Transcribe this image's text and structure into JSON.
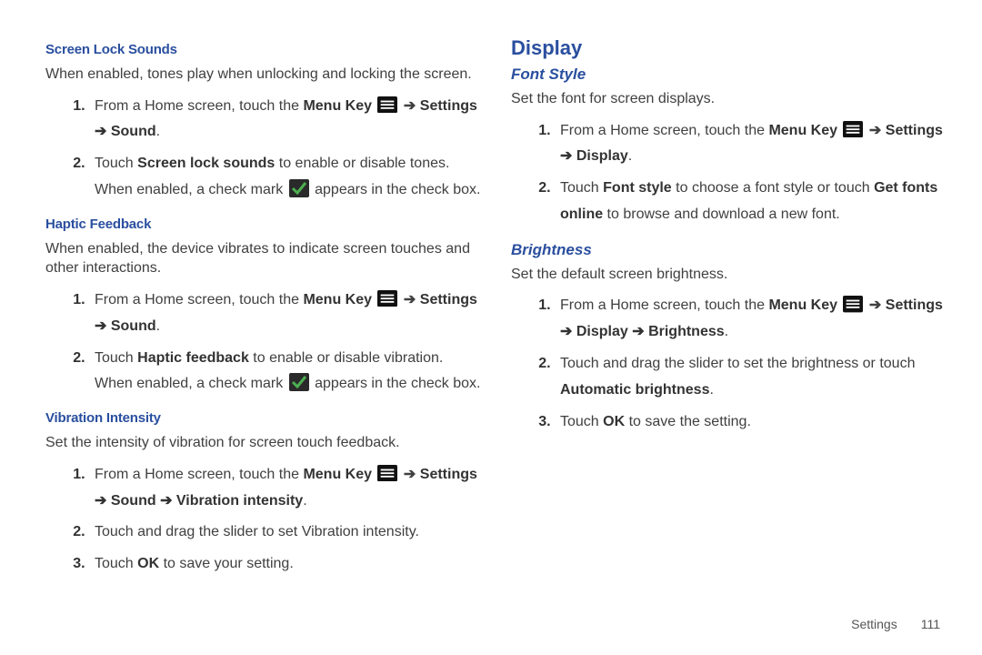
{
  "left": {
    "sections": [
      {
        "heading": "Screen Lock Sounds",
        "intro": "When enabled, tones play when unlocking and locking the screen.",
        "steps": [
          {
            "pre": "From a Home screen, touch the ",
            "b1": "Menu Key",
            "icon": "menu",
            "arrow1": " ➔ ",
            "b2": "Settings",
            "line2arrow": " ➔ ",
            "b3": "Sound",
            "tail": "."
          },
          {
            "pre": "Touch ",
            "b1": "Screen lock sounds",
            "mid": " to enable or disable tones. When enabled, a check mark ",
            "icon": "check",
            "tail": " appears in the check box."
          }
        ]
      },
      {
        "heading": "Haptic Feedback",
        "intro": "When enabled, the device vibrates to indicate screen touches and other interactions.",
        "steps": [
          {
            "pre": "From a Home screen, touch the ",
            "b1": "Menu Key",
            "icon": "menu",
            "arrow1": " ➔ ",
            "b2": "Settings",
            "line2arrow": " ➔ ",
            "b3": "Sound",
            "tail": "."
          },
          {
            "pre": "Touch ",
            "b1": "Haptic feedback",
            "mid": " to enable or disable vibration. When enabled, a check mark ",
            "icon": "check",
            "tail": " appears in the check box."
          }
        ]
      },
      {
        "heading": "Vibration Intensity",
        "intro": "Set the intensity of vibration for screen touch feedback.",
        "steps": [
          {
            "pre": "From a Home screen, touch the ",
            "b1": "Menu Key",
            "icon": "menu",
            "arrow1": " ➔ ",
            "b2": "Settings",
            "line2arrow": " ➔ ",
            "b3": "Sound",
            "mid": " ➔ ",
            "b4": "Vibration intensity",
            "tail": "."
          },
          {
            "pre": "Touch and drag the slider to set Vibration intensity."
          },
          {
            "pre": "Touch ",
            "b1": "OK",
            "mid": " to save your setting."
          }
        ]
      }
    ]
  },
  "right": {
    "title": "Display",
    "sections": [
      {
        "heading": "Font Style",
        "intro": "Set the font for screen displays.",
        "steps": [
          {
            "pre": "From a Home screen, touch the ",
            "b1": "Menu Key",
            "icon": "menu",
            "arrow1": " ➔ ",
            "b2": "Settings",
            "line2arrow": " ➔ ",
            "b3": "Display",
            "tail": "."
          },
          {
            "pre": "Touch ",
            "b1": "Font style",
            "mid": " to choose a font style or touch ",
            "b2": "Get fonts online",
            "tail": " to browse and download a new font."
          }
        ]
      },
      {
        "heading": "Brightness",
        "intro": "Set the default screen brightness.",
        "steps": [
          {
            "pre": "From a Home screen, touch the ",
            "b1": "Menu Key",
            "icon": "menu",
            "arrow1": " ➔ ",
            "b2": "Settings",
            "line2arrow": " ➔ ",
            "b3": "Display",
            "mid": " ➔ ",
            "b4": "Brightness",
            "tail": "."
          },
          {
            "pre": "Touch and drag the slider to set the brightness or touch ",
            "b1": "Automatic brightness",
            "tail": "."
          },
          {
            "pre": "Touch ",
            "b1": "OK",
            "mid": " to save the setting."
          }
        ]
      }
    ]
  },
  "footer": {
    "section": "Settings",
    "page": "111"
  }
}
